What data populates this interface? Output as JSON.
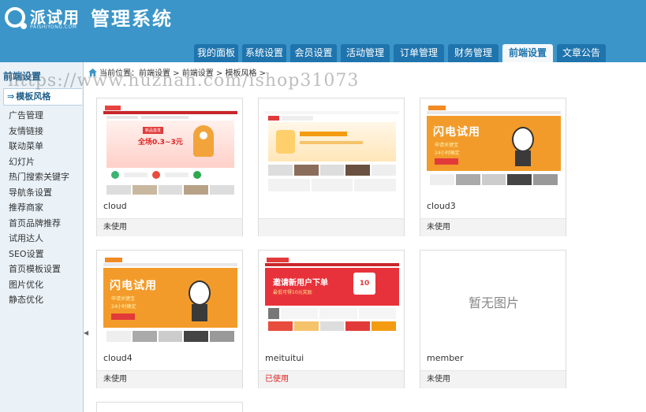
{
  "header": {
    "logo_text": "派试用",
    "logo_sub": "PAISHIYONG.COM",
    "app_title": "管理系统",
    "nav_tabs": [
      "我的面板",
      "系统设置",
      "会员设置",
      "活动管理",
      "订单管理",
      "财务管理",
      "前端设置",
      "文章公告"
    ],
    "active_tab": "前端设置"
  },
  "sidebar": {
    "title": "前端设置",
    "active_item": "模板风格",
    "items": [
      "广告管理",
      "友情链接",
      "联动菜单",
      "幻灯片",
      "热门搜索关键字",
      "导航条设置",
      "推荐商家",
      "首页品牌推荐",
      "试用达人",
      "SEO设置",
      "首页模板设置",
      "图片优化",
      "静态优化"
    ]
  },
  "breadcrumb": {
    "text": "当前位置：前端设置 > 前端设置 > 模板风格 >"
  },
  "watermark": "https://www.huzhan.com/ishop31073",
  "templates": [
    {
      "name": "cloud",
      "status": "未使用",
      "used": false,
      "thumb": "red"
    },
    {
      "name": "",
      "status": "",
      "used": false,
      "thumb": "light"
    },
    {
      "name": "cloud3",
      "status": "未使用",
      "used": false,
      "thumb": "orange"
    },
    {
      "name": "cloud4",
      "status": "未使用",
      "used": false,
      "thumb": "orange"
    },
    {
      "name": "meituitui",
      "status": "已使用",
      "used": true,
      "thumb": "redbanner"
    },
    {
      "name": "member",
      "status": "未使用",
      "used": false,
      "thumb": "none",
      "no_image_text": "暂无图片"
    }
  ],
  "thumb_text": {
    "flash": "闪电试用",
    "flash_sub1": "申请关键宝",
    "flash_sub2": "24小时确定",
    "red_promo": "全场0.3~3元",
    "red_tag": "新品首发",
    "invite": "邀请新用户下单",
    "invite_sub": "最低可得10元奖励",
    "ten": "10"
  },
  "colors": {
    "header_bg": "#3b95c8",
    "tab_bg": "#1f74ad",
    "used_status": "#dd2222"
  }
}
